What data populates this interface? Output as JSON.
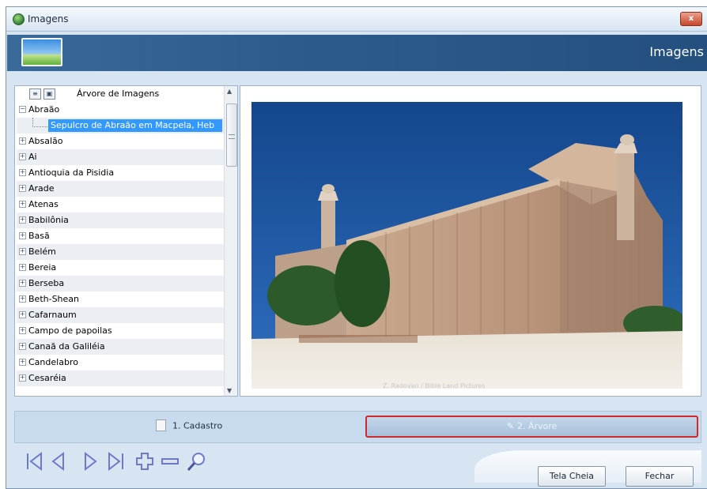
{
  "window": {
    "title": "Imagens",
    "close_label": "x"
  },
  "banner": {
    "title": "Imagens"
  },
  "tree": {
    "header_label": "Árvore de Imagens",
    "items": [
      {
        "label": "Abraão",
        "expanded": true,
        "child": "Sepulcro de Abraão em Macpela, Heb"
      },
      {
        "label": "Absalão"
      },
      {
        "label": "Ai"
      },
      {
        "label": "Antioquia da Pisidia"
      },
      {
        "label": "Arade"
      },
      {
        "label": "Atenas"
      },
      {
        "label": "Babilônia"
      },
      {
        "label": "Basã"
      },
      {
        "label": "Belém"
      },
      {
        "label": "Bereia"
      },
      {
        "label": "Berseba"
      },
      {
        "label": "Beth-Shean"
      },
      {
        "label": "Cafarnaum"
      },
      {
        "label": "Campo de papoilas"
      },
      {
        "label": "Canaã da Galiléia"
      },
      {
        "label": "Candelabro"
      },
      {
        "label": "Cesaréia"
      }
    ]
  },
  "viewer": {
    "caption": "Z. Radovan / Bible Land Pictures"
  },
  "tabs": {
    "tab1": "1. Cadastro",
    "tab2": "2. Árvore"
  },
  "buttons": {
    "fullscreen": "Tela Cheia",
    "close": "Fechar"
  },
  "colors": {
    "selection": "#3399ff",
    "active_tab_border": "#cf2a2a",
    "banner": "#2d5c8c",
    "nav_icons": "#6f79c9"
  }
}
